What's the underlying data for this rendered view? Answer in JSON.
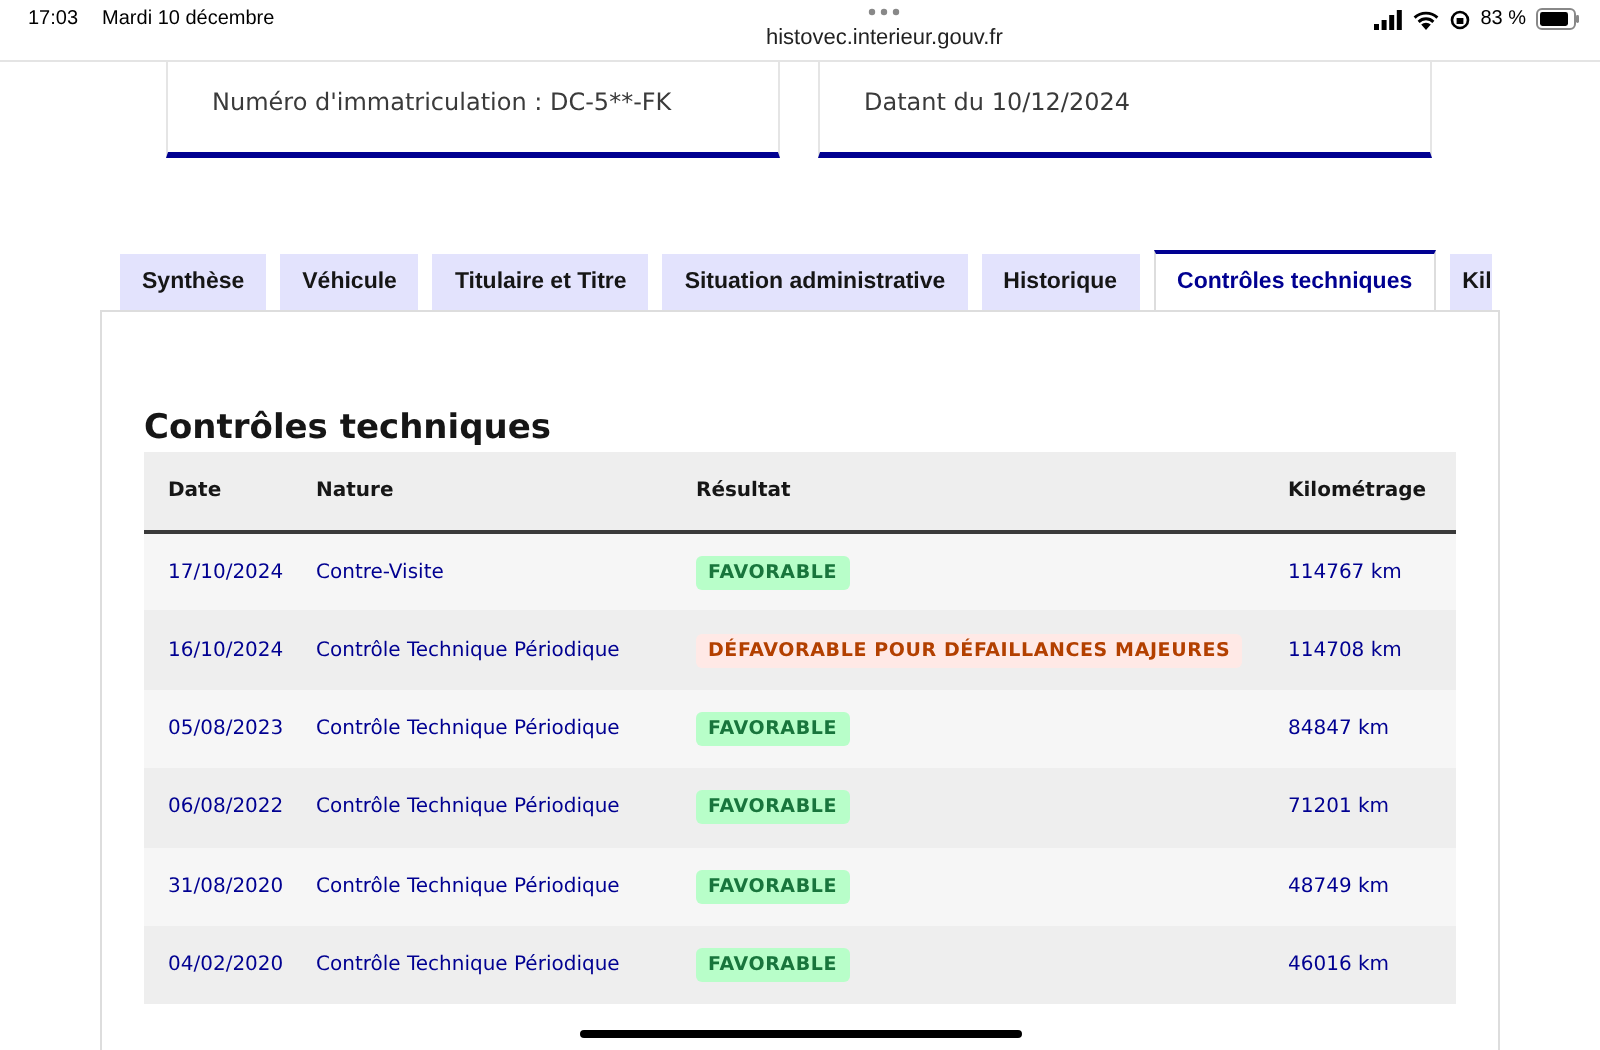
{
  "status_bar": {
    "time": "17:03",
    "date": "Mardi 10 décembre",
    "url": "histovec.interieur.gouv.fr",
    "battery_text": "83 %"
  },
  "cards": [
    {
      "text": "Numéro d'immatriculation : DC-5**-FK"
    },
    {
      "text": "Datant du 10/12/2024"
    }
  ],
  "tabs": [
    {
      "label": "Synthèse",
      "selected": false
    },
    {
      "label": "Véhicule",
      "selected": false
    },
    {
      "label": "Titulaire et Titre",
      "selected": false
    },
    {
      "label": "Situation administrative",
      "selected": false
    },
    {
      "label": "Historique",
      "selected": false
    },
    {
      "label": "Contrôles techniques",
      "selected": true
    },
    {
      "label": "Kil",
      "selected": false
    }
  ],
  "section_title": "Contrôles techniques",
  "table": {
    "columns": [
      "Date",
      "Nature",
      "Résultat",
      "Kilométrage"
    ],
    "rows": [
      {
        "date": "17/10/2024",
        "nature": "Contre-Visite",
        "result": "FAVORABLE",
        "kind": "favorable",
        "mileage": "114767 km"
      },
      {
        "date": "16/10/2024",
        "nature": "Contrôle Technique Périodique",
        "result": "DÉFAVORABLE POUR DÉFAILLANCES MAJEURES",
        "kind": "unfavorable",
        "mileage": "114708 km"
      },
      {
        "date": "05/08/2023",
        "nature": "Contrôle Technique Périodique",
        "result": "FAVORABLE",
        "kind": "favorable",
        "mileage": "84847 km"
      },
      {
        "date": "06/08/2022",
        "nature": "Contrôle Technique Périodique",
        "result": "FAVORABLE",
        "kind": "favorable",
        "mileage": "71201 km"
      },
      {
        "date": "31/08/2020",
        "nature": "Contrôle Technique Périodique",
        "result": "FAVORABLE",
        "kind": "favorable",
        "mileage": "48749 km"
      },
      {
        "date": "04/02/2020",
        "nature": "Contrôle Technique Périodique",
        "result": "FAVORABLE",
        "kind": "favorable",
        "mileage": "46016 km"
      }
    ]
  }
}
